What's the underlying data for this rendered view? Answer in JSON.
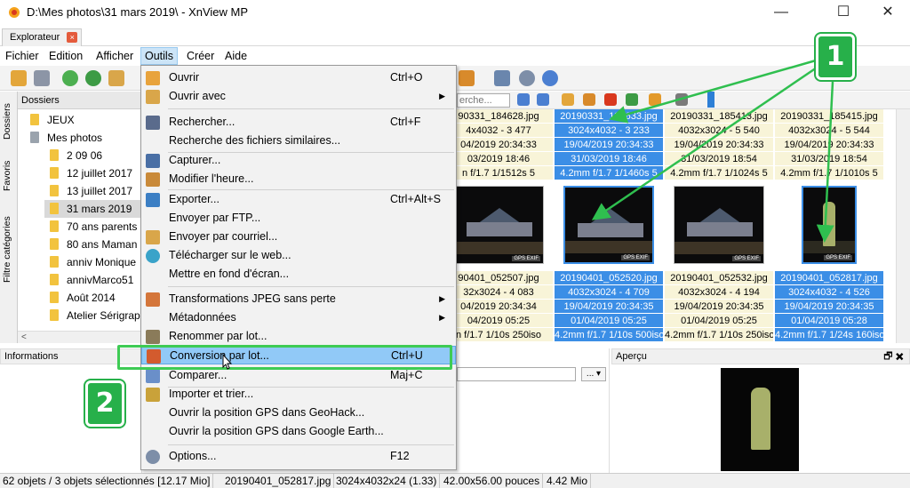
{
  "window": {
    "title": "D:\\Mes photos\\31 mars 2019\\ - XnView MP",
    "minimize": "—",
    "maximize": "☐",
    "close": "✕"
  },
  "tab": {
    "label": "Explorateur",
    "close": "×"
  },
  "menubar": [
    "Fichier",
    "Edition",
    "Afficher",
    "Outils",
    "Créer",
    "Aide"
  ],
  "vtabs": [
    "Dossiers",
    "Favoris",
    "Filtre catégories"
  ],
  "folders": {
    "header": "Dossiers",
    "items": [
      {
        "label": "JEUX"
      },
      {
        "label": "Mes photos"
      },
      {
        "label": "2 09 06"
      },
      {
        "label": "12 juillet 2017"
      },
      {
        "label": "13 juillet 2017"
      },
      {
        "label": "31 mars 2019"
      },
      {
        "label": "70 ans parents"
      },
      {
        "label": "80 ans Maman"
      },
      {
        "label": "anniv Monique"
      },
      {
        "label": "annivMarco51"
      },
      {
        "label": "Août 2014"
      },
      {
        "label": "Atelier Sérigrap"
      }
    ],
    "scroll_left": "<"
  },
  "search": {
    "placeholder": "erche..."
  },
  "thumbs": [
    {
      "top": [
        {
          "text": "90331_184628.jpg",
          "sel": false
        },
        {
          "text": "4x4032 - 3 477",
          "sel": false
        },
        {
          "text": "04/2019 20:34:33",
          "sel": false
        },
        {
          "text": "03/2019 18:46",
          "sel": false
        },
        {
          "text": "n f/1.7 1/1512s 5",
          "sel": false
        }
      ],
      "bottom": [
        {
          "text": "90401_052507.jpg",
          "sel": false
        },
        {
          "text": "32x3024 - 4 083",
          "sel": false
        },
        {
          "text": "04/2019 20:34:34",
          "sel": false
        },
        {
          "text": "04/2019 05:25",
          "sel": false
        },
        {
          "text": "n f/1.7 1/10s 250iso",
          "sel": false
        }
      ],
      "gps": "GPS EXIF"
    },
    {
      "top": [
        {
          "text": "20190331_184633.jpg",
          "sel": true
        },
        {
          "text": "3024x4032 - 3 233",
          "sel": true
        },
        {
          "text": "19/04/2019 20:34:33",
          "sel": true
        },
        {
          "text": "31/03/2019 18:46",
          "sel": true
        },
        {
          "text": "4.2mm f/1.7 1/1460s 5",
          "sel": true
        }
      ],
      "bottom": [
        {
          "text": "20190401_052520.jpg",
          "sel": true
        },
        {
          "text": "4032x3024 - 4 709",
          "sel": true
        },
        {
          "text": "19/04/2019 20:34:35",
          "sel": true
        },
        {
          "text": "01/04/2019 05:25",
          "sel": true
        },
        {
          "text": "4.2mm f/1.7 1/10s 500iso",
          "sel": true
        }
      ],
      "gps": "GPS EXIF"
    },
    {
      "top": [
        {
          "text": "20190331_185413.jpg",
          "sel": false
        },
        {
          "text": "4032x3024 - 5 540",
          "sel": false
        },
        {
          "text": "19/04/2019 20:34:33",
          "sel": false
        },
        {
          "text": "31/03/2019 18:54",
          "sel": false
        },
        {
          "text": "4.2mm f/1.7 1/1024s 5",
          "sel": false
        }
      ],
      "bottom": [
        {
          "text": "20190401_052532.jpg",
          "sel": false
        },
        {
          "text": "4032x3024 - 4 194",
          "sel": false
        },
        {
          "text": "19/04/2019 20:34:35",
          "sel": false
        },
        {
          "text": "01/04/2019 05:25",
          "sel": false
        },
        {
          "text": "4.2mm f/1.7 1/10s 250iso",
          "sel": false
        }
      ],
      "gps": "GPS EXIF"
    },
    {
      "top": [
        {
          "text": "20190331_185415.jpg",
          "sel": false
        },
        {
          "text": "4032x3024 - 5 544",
          "sel": false
        },
        {
          "text": "19/04/2019 20:34:33",
          "sel": false
        },
        {
          "text": "31/03/2019 18:54",
          "sel": false
        },
        {
          "text": "4.2mm f/1.7 1/1010s 5",
          "sel": false
        }
      ],
      "bottom": [
        {
          "text": "20190401_052817.jpg",
          "sel": true
        },
        {
          "text": "3024x4032 - 4 526",
          "sel": true
        },
        {
          "text": "19/04/2019 20:34:35",
          "sel": true
        },
        {
          "text": "01/04/2019 05:28",
          "sel": true
        },
        {
          "text": "4.2mm f/1.7 1/24s 160iso",
          "sel": true
        }
      ],
      "gps": "GPS EXIF"
    }
  ],
  "panels": {
    "informations": "Informations",
    "apercu": "Aperçu",
    "dropdown_btn": "... ▾",
    "pin": "🗗 ✖"
  },
  "menu": {
    "items": [
      {
        "label": "Ouvrir",
        "shortcut": "Ctrl+O",
        "arrow": "",
        "icon": "open-folder-icon",
        "color": "#e8a33c"
      },
      {
        "label": "Ouvrir avec",
        "shortcut": "",
        "arrow": "▶",
        "icon": "open-with-icon",
        "color": "#d9a64a"
      },
      {
        "label": "Rechercher...",
        "shortcut": "Ctrl+F",
        "arrow": "",
        "icon": "binoculars-icon",
        "color": "#5a6b8c"
      },
      {
        "label": "Recherche des fichiers similaires...",
        "shortcut": "",
        "arrow": "",
        "icon": "",
        "color": ""
      },
      {
        "label": "Capturer...",
        "shortcut": "",
        "arrow": "",
        "icon": "capture-icon",
        "color": "#4a6fa5"
      },
      {
        "label": "Modifier l'heure...",
        "shortcut": "",
        "arrow": "",
        "icon": "clock-icon",
        "color": "#c98a3a"
      },
      {
        "label": "Exporter...",
        "shortcut": "Ctrl+Alt+S",
        "arrow": "",
        "icon": "export-icon",
        "color": "#3c7fc4"
      },
      {
        "label": "Envoyer par FTP...",
        "shortcut": "",
        "arrow": "",
        "icon": "",
        "color": ""
      },
      {
        "label": "Envoyer par courriel...",
        "shortcut": "",
        "arrow": "",
        "icon": "mail-icon",
        "color": "#d9a64a"
      },
      {
        "label": "Télécharger sur le web...",
        "shortcut": "",
        "arrow": "",
        "icon": "globe-icon",
        "color": "#3aa3c9"
      },
      {
        "label": "Mettre en fond d'écran...",
        "shortcut": "",
        "arrow": "",
        "icon": "",
        "color": ""
      },
      {
        "label": "Transformations JPEG sans perte",
        "shortcut": "",
        "arrow": "▶",
        "icon": "jpeg-transform-icon",
        "color": "#d4763b"
      },
      {
        "label": "Métadonnées",
        "shortcut": "",
        "arrow": "▶",
        "icon": "",
        "color": ""
      },
      {
        "label": "Renommer par lot...",
        "shortcut": "",
        "arrow": "",
        "icon": "rename-icon",
        "color": "#8a7b5a"
      },
      {
        "label": "Conversion par lot...",
        "shortcut": "Ctrl+U",
        "arrow": "",
        "icon": "batch-convert-icon",
        "color": "#d35b2e"
      },
      {
        "label": "Comparer...",
        "shortcut": "Maj+C",
        "arrow": "",
        "icon": "compare-icon",
        "color": "#6a8fc9"
      },
      {
        "label": "Importer et trier...",
        "shortcut": "",
        "arrow": "",
        "icon": "import-icon",
        "color": "#c9a23a"
      },
      {
        "label": "Ouvrir la position GPS dans GeoHack...",
        "shortcut": "",
        "arrow": "",
        "icon": "",
        "color": ""
      },
      {
        "label": "Ouvrir la position GPS dans Google Earth...",
        "shortcut": "",
        "arrow": "",
        "icon": "",
        "color": ""
      },
      {
        "label": "Options...",
        "shortcut": "F12",
        "arrow": "",
        "icon": "gear-icon",
        "color": "#7d8ea8"
      }
    ]
  },
  "callouts": [
    "1",
    "2"
  ],
  "status": [
    "62 objets / 3 objets sélectionnés [12.17 Mio]",
    "20190401_052817.jpg",
    "3024x4032x24 (1.33)",
    "42.00x56.00 pouces",
    "4.42 Mio"
  ],
  "colors": {
    "selection": "#3b8ee6",
    "info_bg": "#f8f4d8",
    "callout": "#27b04a",
    "menu_highlight": "#91c9f7"
  }
}
